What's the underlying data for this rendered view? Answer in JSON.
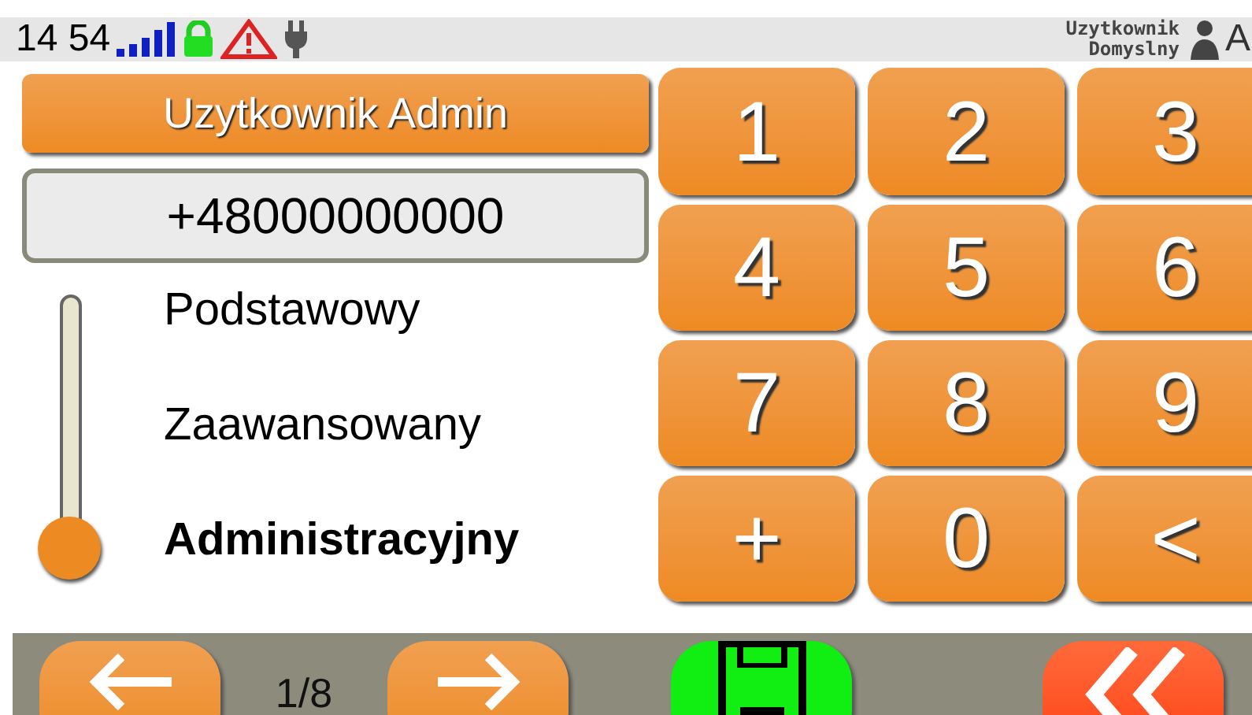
{
  "status_bar": {
    "time": "14 54",
    "user_line_1": "Uzytkownik",
    "user_line_2": "Domyslny",
    "cut_letter": "A"
  },
  "user_button": {
    "label": "Uzytkownik Admin"
  },
  "phone_field": {
    "value": "+48000000000"
  },
  "levels": [
    {
      "label": "Podstawowy",
      "selected": false
    },
    {
      "label": "Zaawansowany",
      "selected": false
    },
    {
      "label": "Administracyjny",
      "selected": true
    }
  ],
  "keypad": [
    {
      "label": "1"
    },
    {
      "label": "2"
    },
    {
      "label": "3"
    },
    {
      "label": "4"
    },
    {
      "label": "5"
    },
    {
      "label": "6"
    },
    {
      "label": "7"
    },
    {
      "label": "8"
    },
    {
      "label": "9"
    },
    {
      "label": "+"
    },
    {
      "label": "0"
    },
    {
      "label": "<"
    }
  ],
  "bottom_bar": {
    "page": "1/8"
  }
}
